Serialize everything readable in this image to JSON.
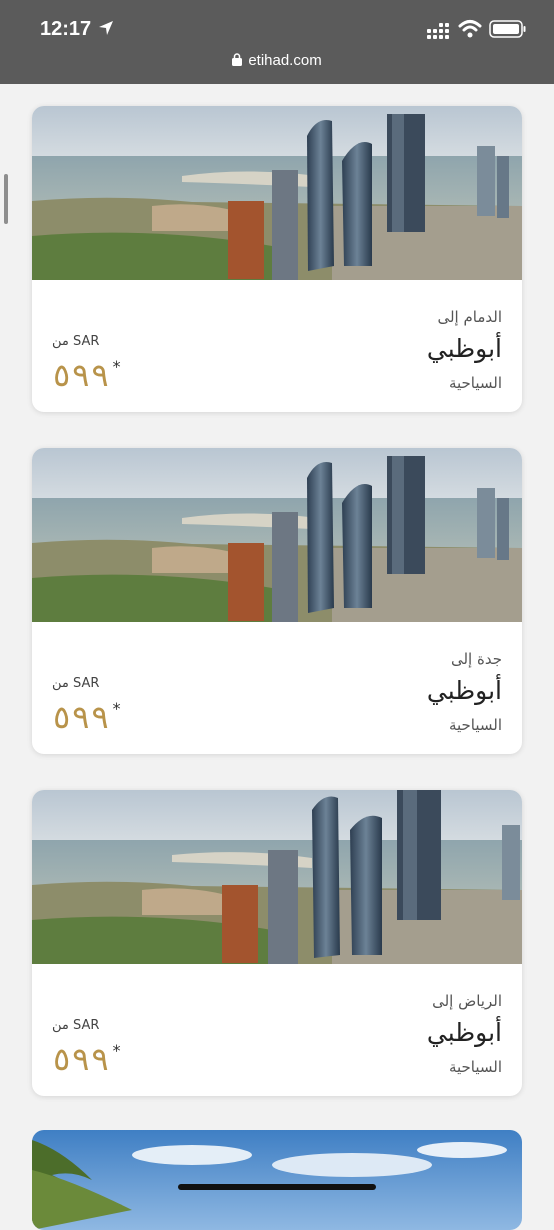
{
  "status": {
    "time": "12:17",
    "url": "etihad.com"
  },
  "offers": [
    {
      "route": "الدمام إلى",
      "destination": "أبوظبي",
      "class": "السياحية",
      "from": "من SAR",
      "price": "٥٩٩",
      "asterisk": "*"
    },
    {
      "route": "جدة إلى",
      "destination": "أبوظبي",
      "class": "السياحية",
      "from": "من SAR",
      "price": "٥٩٩",
      "asterisk": "*"
    },
    {
      "route": "الرياض إلى",
      "destination": "أبوظبي",
      "class": "السياحية",
      "from": "من SAR",
      "price": "٥٩٩",
      "asterisk": "*"
    }
  ],
  "colors": {
    "price": "#b8934a",
    "status_bar": "#5b5b5b"
  },
  "icons": [
    "location-arrow-icon",
    "cellular-signal-icon",
    "wifi-icon",
    "battery-icon",
    "lock-icon"
  ]
}
